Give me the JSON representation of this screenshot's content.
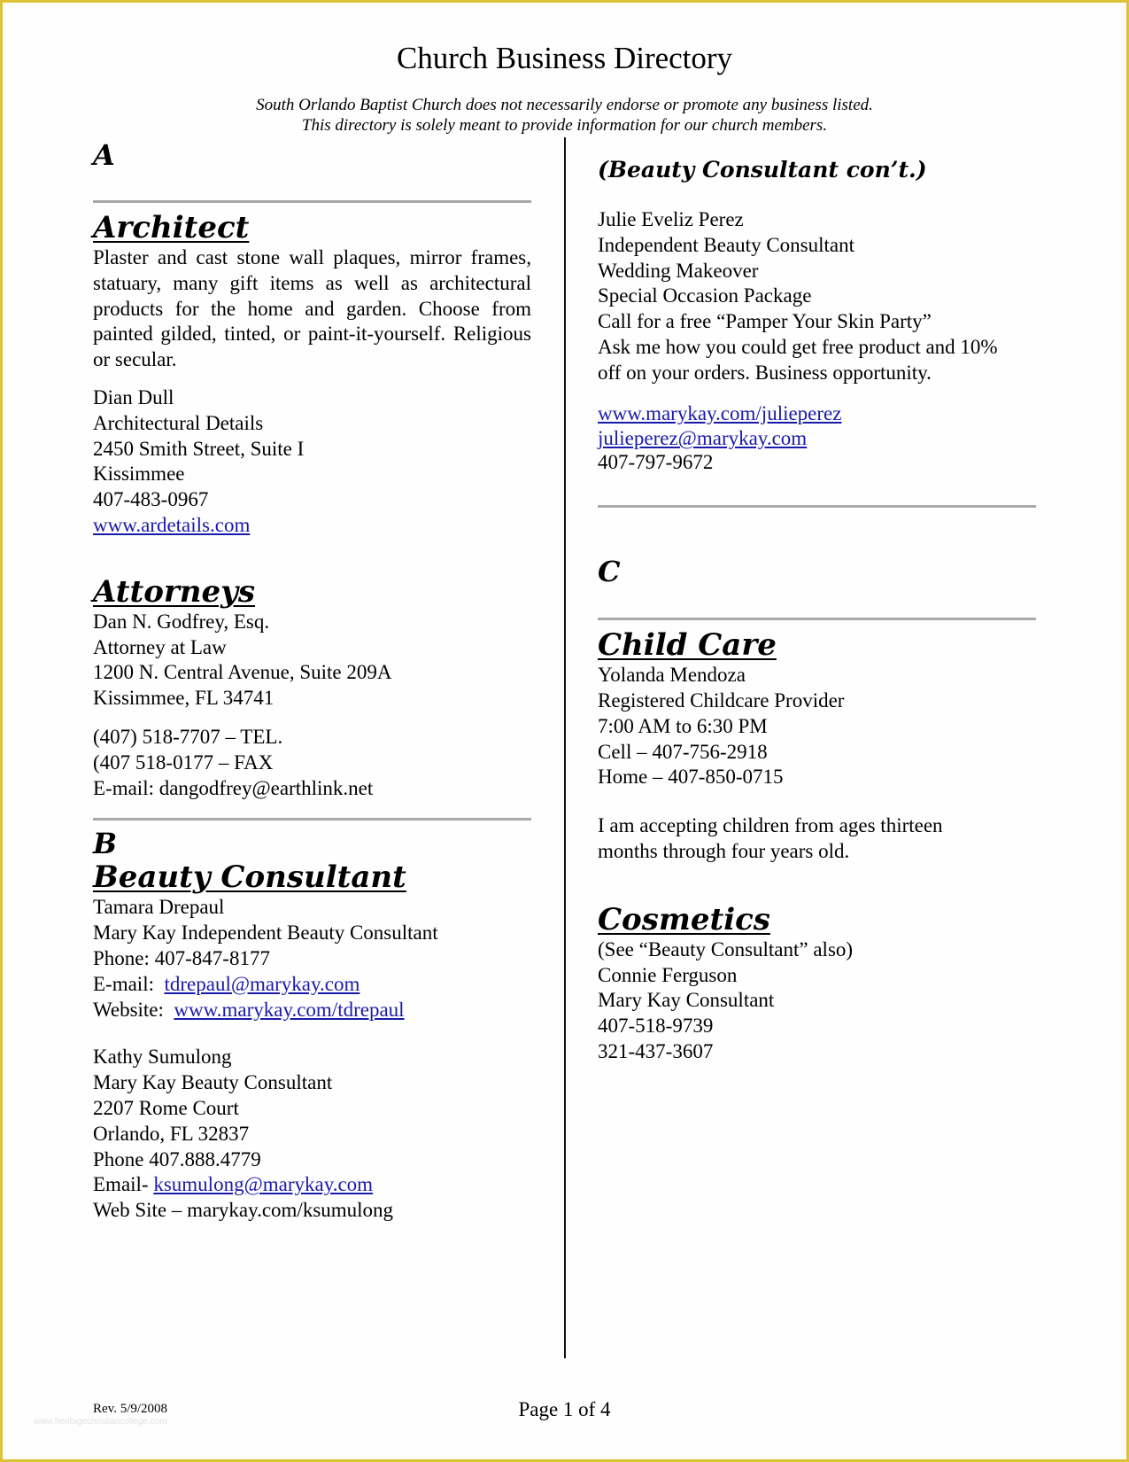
{
  "header": {
    "title": "Church Business Directory",
    "disclaimer_line1": "South Orlando Baptist Church does not necessarily endorse or promote any business listed.",
    "disclaimer_line2": "This directory is solely meant to provide information for our church members."
  },
  "left": {
    "letter_a": "A",
    "architect": {
      "heading": "Architect",
      "description": "Plaster and cast stone wall plaques, mirror frames, statuary, many gift items as well as architectural products for the home and garden. Choose from painted gilded, tinted, or paint-it-yourself. Religious or secular.",
      "name": "Dian Dull",
      "business": "Architectural Details",
      "address": "2450 Smith Street, Suite I",
      "city": "Kissimmee",
      "phone": "407-483-0967",
      "website": "www.ardetails.com"
    },
    "attorneys": {
      "heading": "Attorneys",
      "name": "Dan N. Godfrey, Esq.",
      "title": "Attorney at Law",
      "address": "1200 N. Central Avenue, Suite 209A",
      "city": "Kissimmee, FL 34741",
      "tel": "(407) 518-7707 – TEL.",
      "fax": "(407 518-0177 – FAX",
      "email": "E-mail: dangodfrey@earthlink.net"
    },
    "letter_b": "B",
    "beauty": {
      "heading": "Beauty Consultant",
      "entry1": {
        "name": "Tamara Drepaul",
        "title": "Mary Kay Independent Beauty Consultant",
        "phone": "Phone: 407-847-8177",
        "email_label": "E-mail:  ",
        "email": "tdrepaul@marykay.com",
        "website_label": "Website:  ",
        "website": "www.marykay.com/tdrepaul"
      },
      "entry2": {
        "name": "Kathy Sumulong",
        "title": "Mary Kay Beauty Consultant",
        "address": "2207 Rome Court",
        "city": "Orlando, FL 32837",
        "phone": "Phone 407.888.4779",
        "email_label": "Email- ",
        "email": "ksumulong@marykay.com",
        "website": "Web Site – marykay.com/ksumulong"
      }
    }
  },
  "right": {
    "beauty_cont": {
      "heading": "(Beauty Consultant con’t.)",
      "name": "Julie Eveliz Perez",
      "title": "Independent Beauty Consultant",
      "service1": "Wedding Makeover",
      "service2": "Special Occasion Package",
      "party": "Call for a free “Pamper Your Skin Party”",
      "offer_line1": "Ask me how you could get free product and 10%",
      "offer_line2": "off on your orders. Business opportunity.",
      "website": "www.marykay.com/julieperez",
      "email": "julieperez@marykay.com",
      "phone": "407-797-9672"
    },
    "letter_c": "C",
    "childcare": {
      "heading": "Child Care",
      "name": "Yolanda Mendoza",
      "title": "Registered Childcare Provider",
      "hours": "7:00 AM to 6:30 PM",
      "cell": "Cell – 407-756-2918",
      "home": "Home – 407-850-0715",
      "note_line1": "I am accepting children from ages thirteen",
      "note_line2": "months through four years old."
    },
    "cosmetics": {
      "heading": "Cosmetics",
      "see_also": "(See “Beauty Consultant” also)",
      "name": "Connie Ferguson",
      "title": "Mary Kay Consultant",
      "phone1": "407-518-9739",
      "phone2": "321-437-3607"
    }
  },
  "footer": {
    "revision": "Rev. 5/9/2008",
    "page": "Page 1 of 4",
    "watermark": "www.heritagechristiancollege.com"
  },
  "colors": {
    "border": "#dcc236",
    "link": "#1a1aaa",
    "rule": "#a9a9a9"
  }
}
